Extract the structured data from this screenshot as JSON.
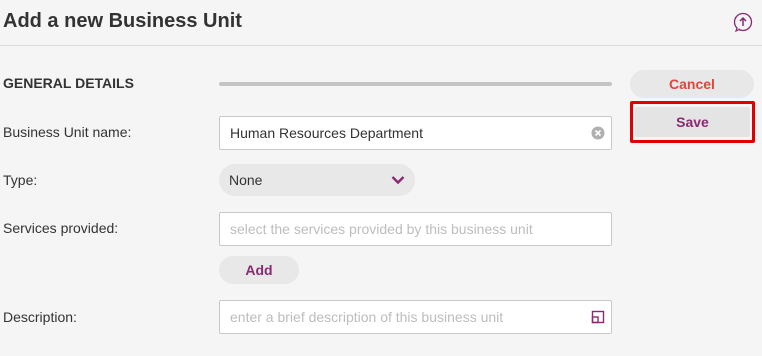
{
  "header": {
    "title": "Add a new Business Unit",
    "help_icon": "upload-chat-icon"
  },
  "section": {
    "title": "GENERAL DETAILS"
  },
  "form": {
    "name_label": "Business Unit name:",
    "name_value": "Human Resources Department",
    "type_label": "Type:",
    "type_value": "None",
    "services_label": "Services provided:",
    "services_placeholder": "select the services provided by this business unit",
    "add_label": "Add",
    "description_label": "Description:",
    "description_placeholder": "enter a brief description of this business unit"
  },
  "actions": {
    "cancel_label": "Cancel",
    "save_label": "Save"
  },
  "colors": {
    "accent": "#8a2a72",
    "cancel": "#e0463a",
    "highlight": "#e00000"
  }
}
